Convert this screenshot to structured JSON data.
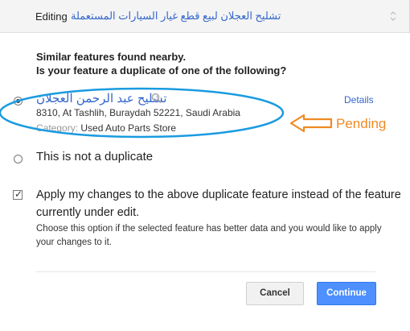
{
  "header": {
    "editing_label": "Editing",
    "editing_title": "تشليح العجلان لبيع قطع غيار السيارات المستعملة"
  },
  "prompt": {
    "line1": "Similar features found nearby.",
    "line2": "Is your feature a duplicate of one of the following?"
  },
  "candidate": {
    "name": "تشليح عبد الرحمن العجلان",
    "address": "8310, At Tashlih, Buraydah 52221, Saudi Arabia",
    "category_label": "Category:",
    "category_value": "Used Auto Parts Store",
    "details_label": "Details",
    "selected": true
  },
  "annotation": {
    "pending_label": "Pending",
    "color": "#f08a24",
    "ellipse_color": "#1a9be0"
  },
  "not_duplicate_label": "This is not a duplicate",
  "apply_option": {
    "checked": true,
    "label": "Apply my changes to the above duplicate feature instead of the feature currently under edit.",
    "hint": "Choose this option if the selected feature has better data and you would like to apply your changes to it."
  },
  "buttons": {
    "cancel": "Cancel",
    "continue": "Continue"
  },
  "colors": {
    "link": "#3366cc",
    "primary_button": "#4d90fe"
  }
}
